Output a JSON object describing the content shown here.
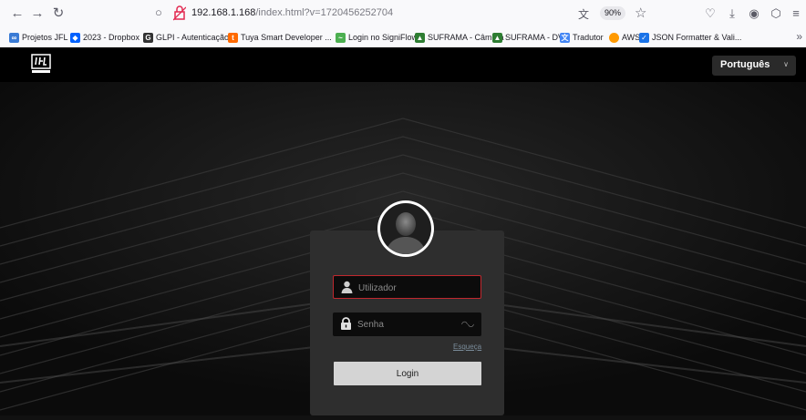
{
  "browser": {
    "url_host": "192.168.1.168",
    "url_path": "/index.html?v=1720456252704",
    "zoom": "90%"
  },
  "bookmarks": [
    {
      "label": "Projetos JFL",
      "icon": "link-icon",
      "color": "#3a7bd5"
    },
    {
      "label": "2023 - Dropbox",
      "icon": "dropbox-icon",
      "color": "#0061fe"
    },
    {
      "label": "GLPI - Autenticação",
      "icon": "glpi-icon",
      "color": "#333333"
    },
    {
      "label": "Tuya Smart Developer ...",
      "icon": "tuya-icon",
      "color": "#ff6a00"
    },
    {
      "label": "Login no SigniFlow",
      "icon": "signiflow-icon",
      "color": "#4caf50"
    },
    {
      "label": "SUFRAMA - Câmera",
      "icon": "suframa-icon",
      "color": "#2e7d32"
    },
    {
      "label": "SUFRAMA - DVR",
      "icon": "suframa-icon",
      "color": "#2e7d32"
    },
    {
      "label": "Tradutor",
      "icon": "translate-icon",
      "color": "#4285f4"
    },
    {
      "label": "AWS",
      "icon": "aws-icon",
      "color": "#ff9900"
    },
    {
      "label": "JSON Formatter & Vali...",
      "icon": "checkbox-icon",
      "color": "#1a73e8"
    }
  ],
  "header": {
    "language": "Português"
  },
  "login": {
    "user_placeholder": "Utilizador",
    "pass_placeholder": "Senha",
    "forgot_label": "Esqueça",
    "login_label": "Login"
  },
  "colors": {
    "accent_border": "#c0282e",
    "background": "#101010",
    "card": "#2e2e2e"
  }
}
